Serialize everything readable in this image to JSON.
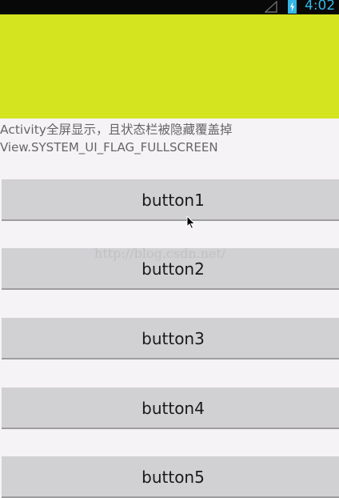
{
  "status_bar": {
    "time": "4:02",
    "icons": [
      "signal-icon",
      "battery-icon"
    ],
    "accent_color": "#33b5e5"
  },
  "header_block": {
    "color": "#d4e41e"
  },
  "description": {
    "line1": "Activity全屏显示，且状态栏被隐藏覆盖掉",
    "line2": "View.SYSTEM_UI_FLAG_FULLSCREEN"
  },
  "buttons": [
    {
      "label": "button1"
    },
    {
      "label": "button2"
    },
    {
      "label": "button3"
    },
    {
      "label": "button4"
    },
    {
      "label": "button5"
    }
  ],
  "watermark": "http://blog.csdn.net/"
}
